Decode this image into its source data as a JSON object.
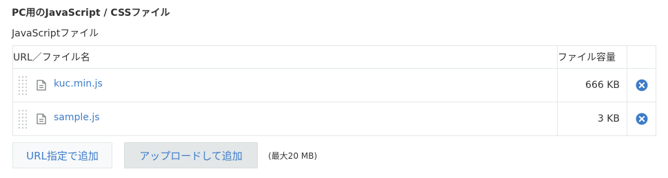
{
  "section": {
    "title": "PC用のJavaScript / CSSファイル",
    "subtitle": "JavaScriptファイル"
  },
  "table": {
    "columns": {
      "name": "URL／ファイル名",
      "size": "ファイル容量"
    },
    "rows": [
      {
        "name": "kuc.min.js",
        "size": "666 KB"
      },
      {
        "name": "sample.js",
        "size": "3 KB"
      }
    ]
  },
  "buttons": {
    "add_url": "URL指定で追加",
    "upload": "アップロードして追加"
  },
  "limit_note": "(最大20 MB)",
  "colors": {
    "link": "#3d7cc9",
    "remove": "#3d7cc9",
    "border": "#e3e7e8"
  },
  "icons": {
    "drag": "drag-handle-icon",
    "file": "file-icon",
    "remove": "remove-circle-x-icon"
  }
}
